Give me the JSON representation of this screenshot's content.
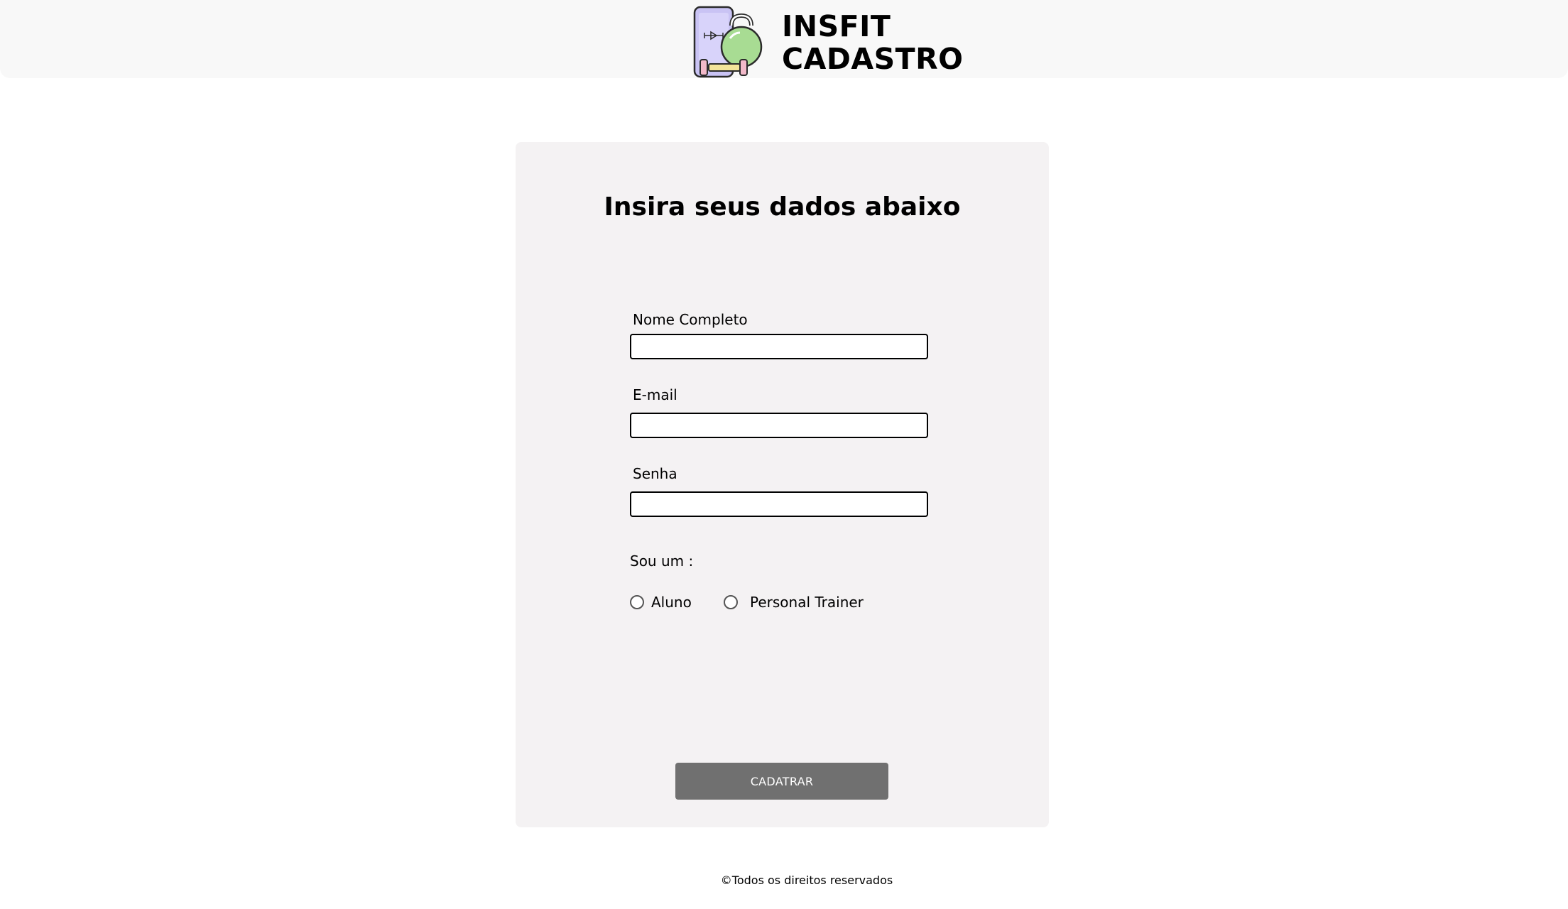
{
  "header": {
    "brand_line1": "INSFIT",
    "brand_line2": "CADASTRO",
    "logo_icon": "phone-kettlebell-dumbbell-icon"
  },
  "form": {
    "title": "Insira seus dados abaixo",
    "fields": [
      {
        "label": "Nome Completo",
        "value": ""
      },
      {
        "label": "E-mail",
        "value": ""
      },
      {
        "label": "Senha",
        "value": ""
      }
    ],
    "role_label": "Sou um :",
    "role_options": [
      "Aluno",
      "Personal Trainer"
    ],
    "submit_label": "CADATRAR"
  },
  "footer": {
    "text": "©Todos os direitos reservados"
  },
  "colors": {
    "header_bg": "#f8f8f8",
    "card_bg": "#f4f2f3",
    "button_bg": "#707070",
    "logo_phone": "#c9c3f4",
    "logo_kettlebell": "#a8dc93",
    "logo_dumbbell": "#f3e49a",
    "logo_weights": "#f2b9c9"
  }
}
